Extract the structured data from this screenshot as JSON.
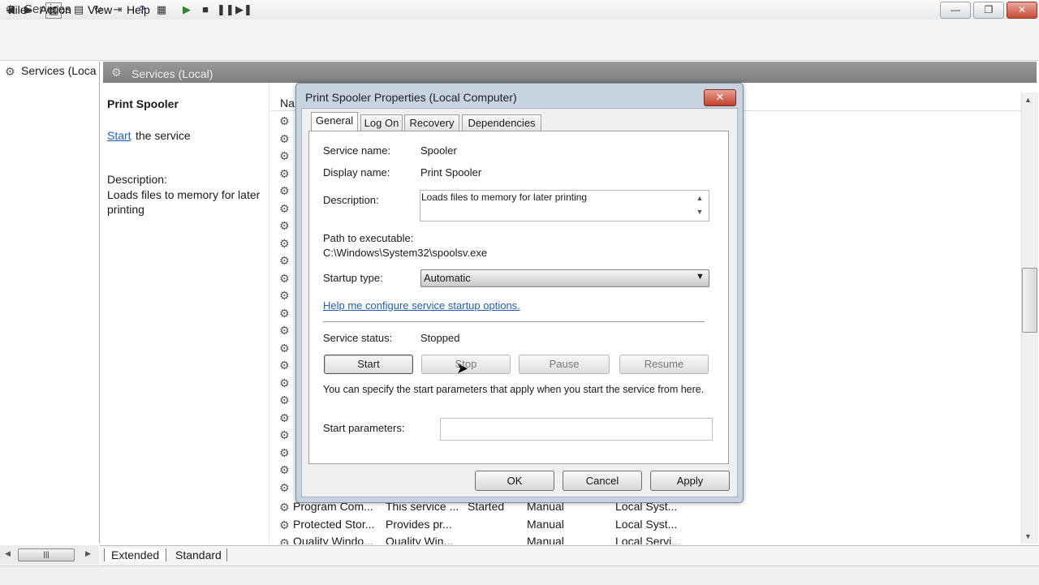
{
  "window": {
    "title": "Services",
    "controls": {
      "minimize": "—",
      "maximize": "❐",
      "close": "✕"
    }
  },
  "menu": [
    "File",
    "Action",
    "View",
    "Help"
  ],
  "tree": {
    "item": "Services (Loca"
  },
  "scope_header": "Services (Local)",
  "left_pane": {
    "service_title": "Print Spooler",
    "start_link": "Start",
    "start_suffix": "the service",
    "description_label": "Description:",
    "description_text": "Loads files to memory for later printing"
  },
  "list": {
    "name_header": "Na",
    "rows": [
      {
        "name": "Program Com...",
        "description": "This service ...",
        "status": "Started",
        "startup": "Manual",
        "logon": "Local Syst..."
      },
      {
        "name": "Protected Stor...",
        "description": "Provides pr...",
        "status": "",
        "startup": "Manual",
        "logon": "Local Syst..."
      },
      {
        "name": "Quality Windo...",
        "description": "Quality Win...",
        "status": "",
        "startup": "Manual",
        "logon": "Local Servi..."
      }
    ]
  },
  "bottom_tabs": [
    "Extended",
    "Standard"
  ],
  "dialog": {
    "title": "Print Spooler Properties (Local Computer)",
    "tabs": [
      "General",
      "Log On",
      "Recovery",
      "Dependencies"
    ],
    "fields": {
      "service_name_label": "Service name:",
      "service_name": "Spooler",
      "display_name_label": "Display name:",
      "display_name": "Print Spooler",
      "description_label": "Description:",
      "description": "Loads files to memory for later printing",
      "path_label": "Path to executable:",
      "path": "C:\\Windows\\System32\\spoolsv.exe",
      "startup_type_label": "Startup type:",
      "startup_type": "Automatic",
      "help_link": "Help me configure service startup options.",
      "status_label": "Service status:",
      "status": "Stopped"
    },
    "control_buttons": {
      "start": "Start",
      "stop": "Stop",
      "pause": "Pause",
      "resume": "Resume"
    },
    "note": "You can specify the start parameters that apply when you start the service from here.",
    "start_params_label": "Start parameters:",
    "start_params_value": "",
    "footer_buttons": {
      "ok": "OK",
      "cancel": "Cancel",
      "apply": "Apply"
    }
  }
}
